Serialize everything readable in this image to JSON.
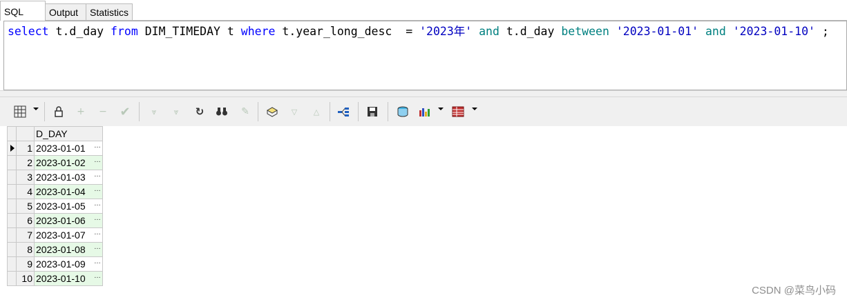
{
  "tabs": [
    {
      "label": "SQL"
    },
    {
      "label": "Output"
    },
    {
      "label": "Statistics"
    }
  ],
  "editor": {
    "tokens": [
      {
        "t": "select",
        "c": "kw"
      },
      {
        "t": " t.d_day ",
        "c": ""
      },
      {
        "t": "from",
        "c": "kw"
      },
      {
        "t": " DIM_TIMEDAY t ",
        "c": ""
      },
      {
        "t": "where",
        "c": "kw"
      },
      {
        "t": " t.year_long_desc  = ",
        "c": ""
      },
      {
        "t": "'2023年'",
        "c": "str"
      },
      {
        "t": " ",
        "c": ""
      },
      {
        "t": "and",
        "c": "kw2"
      },
      {
        "t": " t.d_day ",
        "c": ""
      },
      {
        "t": "between",
        "c": "kw2"
      },
      {
        "t": " ",
        "c": ""
      },
      {
        "t": "'2023-01-01'",
        "c": "str"
      },
      {
        "t": " ",
        "c": ""
      },
      {
        "t": "and",
        "c": "kw2"
      },
      {
        "t": " ",
        "c": ""
      },
      {
        "t": "'2023-01-10'",
        "c": "str"
      },
      {
        "t": " ;",
        "c": ""
      }
    ]
  },
  "toolbar": {
    "icons": [
      "grid-view-icon",
      "lock-icon",
      "add-record-icon",
      "delete-record-icon",
      "post-record-icon",
      "fetch-next-icon",
      "fetch-last-icon",
      "refresh-icon",
      "find-icon",
      "clear-icon",
      "query-by-example-icon",
      "previous-icon",
      "next-icon",
      "explain-plan-icon",
      "save-icon",
      "export-icon",
      "chart-icon",
      "single-record-view-icon"
    ]
  },
  "grid": {
    "header": "D_DAY",
    "ellipsis": "…",
    "rows": [
      {
        "n": "1",
        "v": "2023-01-01"
      },
      {
        "n": "2",
        "v": "2023-01-02"
      },
      {
        "n": "3",
        "v": "2023-01-03"
      },
      {
        "n": "4",
        "v": "2023-01-04"
      },
      {
        "n": "5",
        "v": "2023-01-05"
      },
      {
        "n": "6",
        "v": "2023-01-06"
      },
      {
        "n": "7",
        "v": "2023-01-07"
      },
      {
        "n": "8",
        "v": "2023-01-08"
      },
      {
        "n": "9",
        "v": "2023-01-09"
      },
      {
        "n": "10",
        "v": "2023-01-10"
      }
    ]
  },
  "watermark": "CSDN @菜鸟小码"
}
